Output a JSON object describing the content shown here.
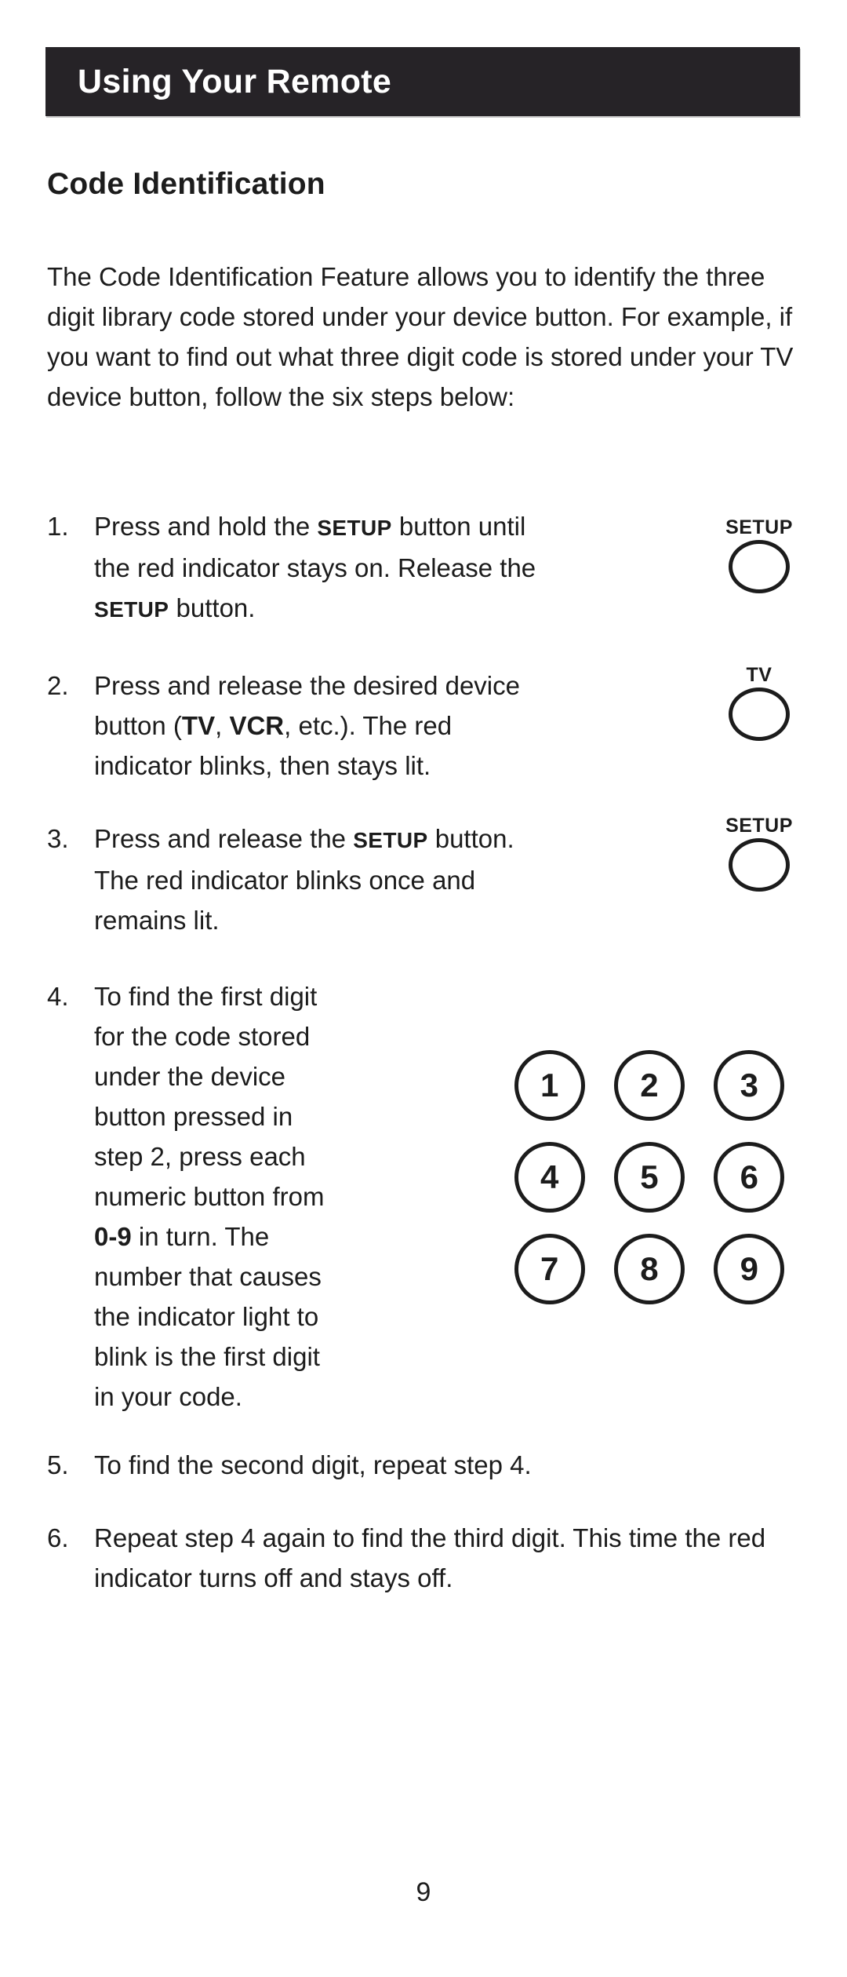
{
  "header": {
    "title": "Using Your Remote"
  },
  "section": {
    "heading": "Code Identification",
    "intro": "The Code Identification Feature allows you to identify the three digit library code stored under your device button. For example, if you want to find out what three digit code is stored under your TV device button, follow the six steps below:"
  },
  "steps": [
    {
      "number": "1.",
      "text_parts": {
        "p1": "Press and hold the ",
        "kw1": "SETUP",
        "p2": " button until the red indicator stays on. Release the ",
        "kw2": "SETUP",
        "p3": " button."
      },
      "button": {
        "label": "SETUP",
        "shape": "oval-button-icon"
      }
    },
    {
      "number": "2.",
      "text_parts": {
        "p1": "Press and release the desired device button (",
        "kw1": "TV",
        "p2": ", ",
        "kw2": "VCR",
        "p3": ", etc.). The red indicator blinks, then stays lit."
      },
      "button": {
        "label": "TV",
        "shape": "oval-button-icon"
      }
    },
    {
      "number": "3.",
      "text_parts": {
        "p1": "Press and release the ",
        "kw1": "SETUP",
        "p2": " button. The red indicator blinks once and remains lit."
      },
      "button": {
        "label": "SETUP",
        "shape": "oval-button-icon"
      }
    },
    {
      "number": "4.",
      "text_parts": {
        "p1": "To find the first digit for the code stored under the device button pressed in step 2, press each numeric button from ",
        "kw1": "0-9",
        "p2": " in turn. The number that causes the indicator light to blink is the first digit in your code."
      }
    },
    {
      "number": "5.",
      "text_parts": {
        "p1": "To find the second digit, repeat step 4."
      }
    },
    {
      "number": "6.",
      "text_parts": {
        "p1": "Repeat step 4 again to find the third digit. This time the red indicator turns off and stays off."
      }
    }
  ],
  "keypad": {
    "keys": [
      "1",
      "2",
      "3",
      "4",
      "5",
      "6",
      "7",
      "8",
      "9"
    ]
  },
  "footer": {
    "page_number": "9"
  },
  "colors": {
    "header_bar": "#262327",
    "header_text": "#ffffff",
    "body_text": "#1c1c1c",
    "page_background": "#ffffff"
  }
}
